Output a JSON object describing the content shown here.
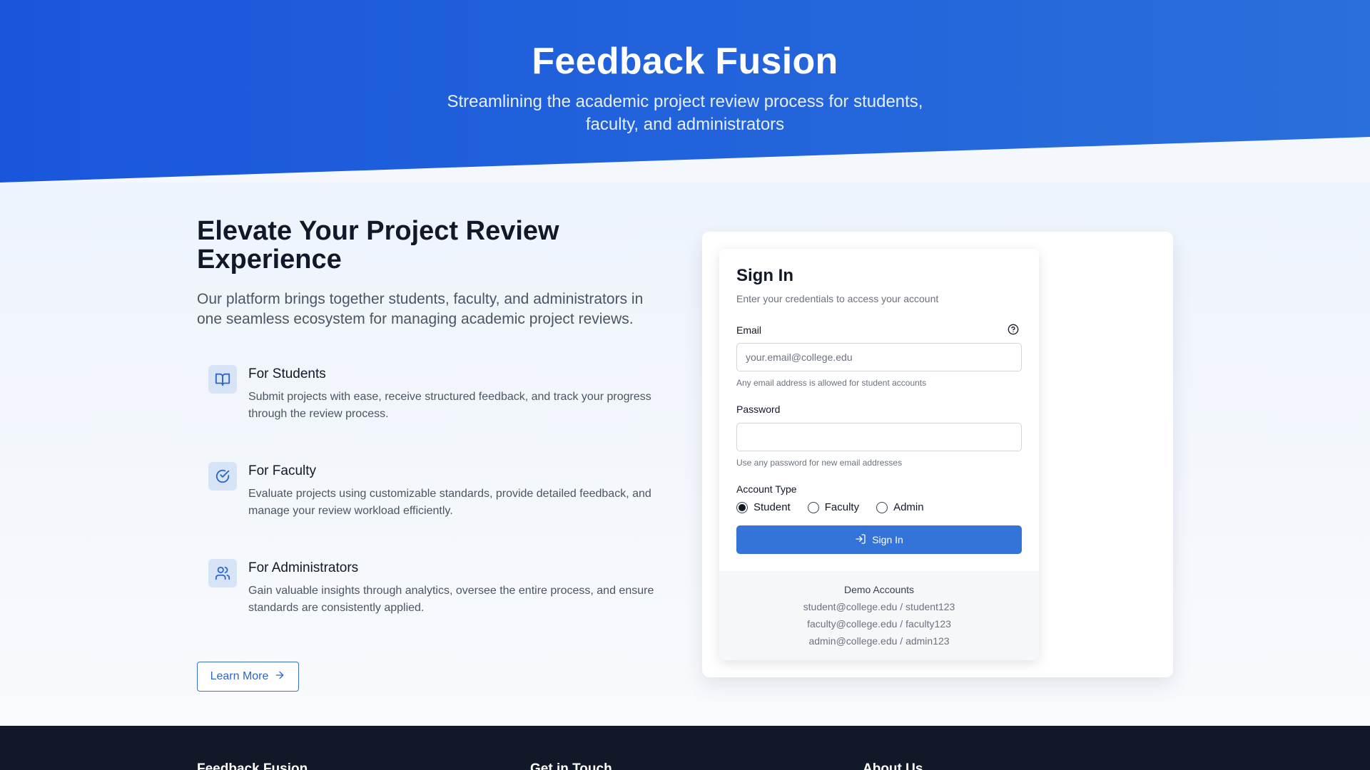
{
  "hero": {
    "title": "Feedback Fusion",
    "subtitle": "Streamlining the academic project review process for students, faculty, and administrators"
  },
  "intro": {
    "title": "Elevate Your Project Review Experience",
    "description": "Our platform brings together students, faculty, and administrators in one seamless ecosystem for managing academic project reviews."
  },
  "features": [
    {
      "icon": "book-open-icon",
      "title": "For Students",
      "description": "Submit projects with ease, receive structured feedback, and track your progress through the review process."
    },
    {
      "icon": "check-circle-icon",
      "title": "For Faculty",
      "description": "Evaluate projects using customizable standards, provide detailed feedback, and manage your review workload efficiently."
    },
    {
      "icon": "users-icon",
      "title": "For Administrators",
      "description": "Gain valuable insights through analytics, oversee the entire process, and ensure standards are consistently applied."
    }
  ],
  "learn_more": {
    "label": "Learn More",
    "icon": "arrow-right-icon"
  },
  "signin": {
    "title": "Sign In",
    "subtitle": "Enter your credentials to access your account",
    "email_label": "Email",
    "email_help_icon": "help-circle-icon",
    "email_placeholder": "your.email@college.edu",
    "email_value": "",
    "email_hint": "Any email address is allowed for student accounts",
    "password_label": "Password",
    "password_value": "",
    "password_hint": "Use any password for new email addresses",
    "account_type_label": "Account Type",
    "account_types": [
      "Student",
      "Faculty",
      "Admin"
    ],
    "selected_account_type": "Student",
    "button_label": "Sign In",
    "button_icon": "log-in-icon"
  },
  "demo": {
    "title": "Demo Accounts",
    "accounts": [
      "student@college.edu / student123",
      "faculty@college.edu / faculty123",
      "admin@college.edu / admin123"
    ]
  },
  "footer": {
    "columns": [
      "Feedback Fusion",
      "Get in Touch",
      "About Us"
    ]
  },
  "colors": {
    "primary": "#1a56db",
    "button": "#3474d8",
    "footer": "#111827"
  }
}
